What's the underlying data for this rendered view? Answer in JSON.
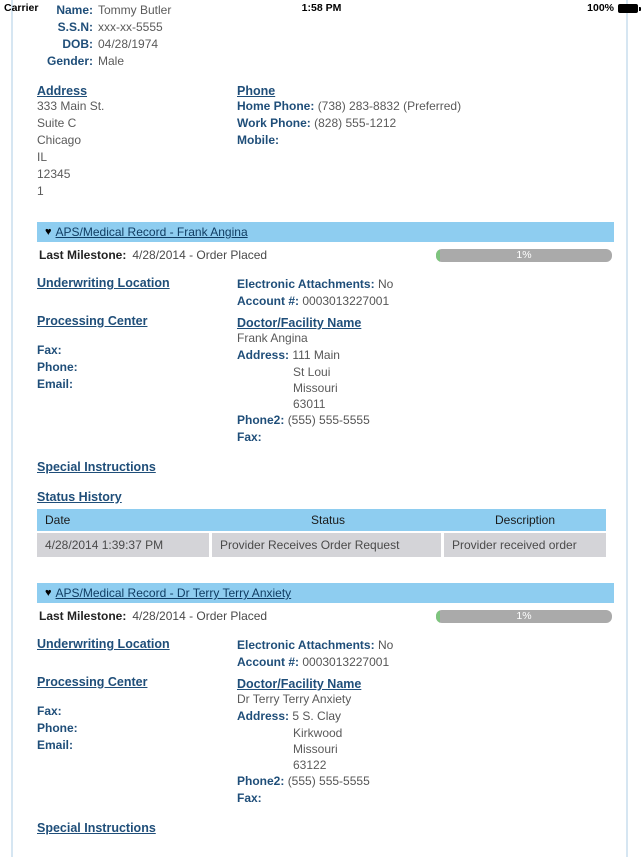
{
  "statusbar": {
    "carrier": "Carrier",
    "time": "1:58 PM",
    "battery_percent": "100%",
    "battery_icon": "battery-full-icon"
  },
  "applicant": {
    "fields": [
      {
        "label": "Name:",
        "value": "Tommy Butler"
      },
      {
        "label": "S.S.N:",
        "value": "xxx-xx-5555"
      },
      {
        "label": "DOB:",
        "value": "04/28/1974"
      },
      {
        "label": "Gender:",
        "value": "Male"
      }
    ],
    "address": {
      "heading": "Address",
      "lines": [
        "333 Main St.",
        "Suite C",
        "Chicago",
        "IL",
        "12345",
        "1"
      ]
    },
    "phone": {
      "heading": "Phone",
      "rows": [
        {
          "label": "Home Phone:",
          "value": "(738) 283-8832 (Preferred)"
        },
        {
          "label": "Work Phone:",
          "value": "(828) 555-1212"
        },
        {
          "label": "Mobile:",
          "value": ""
        }
      ]
    }
  },
  "labels": {
    "underwriting_location": "Underwriting Location",
    "processing_center": "Processing Center",
    "doctor_facility_name": "Doctor/Facility Name",
    "special_instructions": "Special Instructions",
    "status_history": "Status History",
    "last_milestone": "Last Milestone:",
    "fax": "Fax:",
    "phone": "Phone:",
    "email": "Email:",
    "electronic_attachments": "Electronic Attachments:",
    "account_number": "Account #:",
    "address": "Address:",
    "phone2": "Phone2:",
    "caret_glyph": "♥"
  },
  "table_headers": {
    "date": "Date",
    "status": "Status",
    "description": "Description"
  },
  "colors": {
    "section_header_bg": "#8ecdf0",
    "link_blue": "#1f4e79",
    "progress_track": "#aaaaaa",
    "progress_fill": "#7ec47e",
    "table_row_bg": "#d4d4d8",
    "page_border": "#d6e6f2"
  },
  "records": [
    {
      "title": "APS/Medical Record - Frank Angina",
      "milestone_value": "4/28/2014 - Order Placed",
      "progress_text": "1%",
      "progress_percent": 1,
      "fax": "",
      "phone": "",
      "email": "",
      "electronic_attachments": "No",
      "account": "0003013227001",
      "doctor_name": "Frank Angina",
      "address_first": "111 Main",
      "address_rest": [
        "St Loui",
        "Missouri",
        "63011"
      ],
      "phone2": "(555) 555-5555",
      "doc_fax": "",
      "has_status_history": true,
      "status_history": [
        {
          "date": "4/28/2014 1:39:37 PM",
          "status": "Provider Receives Order Request",
          "description": "Provider received order"
        }
      ]
    },
    {
      "title": "APS/Medical Record - Dr Terry Terry Anxiety",
      "milestone_value": "4/28/2014 - Order Placed",
      "progress_text": "1%",
      "progress_percent": 1,
      "fax": "",
      "phone": "",
      "email": "",
      "electronic_attachments": "No",
      "account": "0003013227001",
      "doctor_name": "Dr Terry Terry Anxiety",
      "address_first": "5 S. Clay",
      "address_rest": [
        "Kirkwood",
        "Missouri",
        "63122"
      ],
      "phone2": "(555) 555-5555",
      "doc_fax": "",
      "has_status_history": false,
      "status_history": []
    }
  ]
}
